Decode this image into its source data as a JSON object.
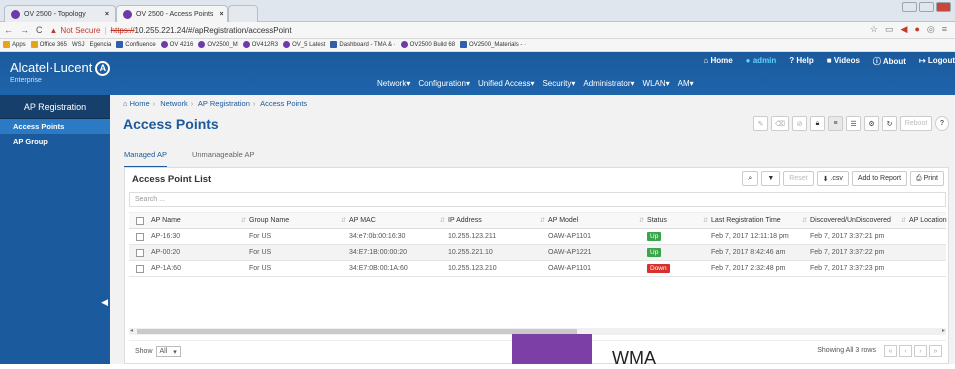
{
  "browser": {
    "tabs": [
      {
        "title": "OV 2500 - Topology"
      },
      {
        "title": "OV 2500 - Access Points"
      }
    ],
    "not_secure": "Not Secure",
    "url_scheme": "https://",
    "url_rest": "10.255.221.24/#/apRegistration/accessPoint",
    "bookmarks": [
      "Apps",
      "Office 365",
      "WSJ",
      "Egencia",
      "Confluence",
      "OV 4216",
      "OV2500_M",
      "OV412R3",
      "OV_5 Latest",
      "Dashboard - TMA & ·",
      "OV2500 Build 68",
      "OV2500_Materials - ·"
    ]
  },
  "header": {
    "brand": "Alcatel·Lucent",
    "brand_sub": "Enterprise",
    "brand_mark": "A",
    "utils": {
      "home": "Home",
      "user": "admin",
      "help": "Help",
      "videos": "Videos",
      "about": "About",
      "logout": "Logout"
    },
    "menu": [
      "Network",
      "Configuration",
      "Unified Access",
      "Security",
      "Administrator",
      "WLAN",
      "AM"
    ]
  },
  "sidebar": {
    "title": "AP Registration",
    "items": [
      {
        "label": "Access Points",
        "active": true
      },
      {
        "label": "AP Group",
        "active": false
      }
    ]
  },
  "breadcrumb": [
    "Home",
    "Network",
    "AP Registration",
    "Access Points"
  ],
  "page_title": "Access Points",
  "toolbar": {
    "reboot": "Reboot",
    "help": "?"
  },
  "subtabs": [
    "Managed AP",
    "Unmanageable AP"
  ],
  "panel": {
    "title": "Access Point List",
    "buttons": {
      "reset": "Reset",
      "csv": ".csv",
      "add_report": "Add to Report",
      "print": "Print"
    },
    "search_placeholder": "Search ...",
    "columns": [
      "AP Name",
      "Group Name",
      "AP MAC",
      "IP Address",
      "AP Model",
      "Status",
      "Last Registration Time",
      "Discovered/UnDiscovered",
      "AP Location"
    ],
    "rows": [
      {
        "name": "AP-16:30",
        "group": "For US",
        "mac": "34:e7:0b:00:16:30",
        "ip": "10.255.123.211",
        "model": "OAW-AP1101",
        "status": "Up",
        "last_reg": "Feb 7, 2017 12:11:18 pm",
        "discovered": "Feb 7, 2017 3:37:21 pm"
      },
      {
        "name": "AP-00:20",
        "group": "For US",
        "mac": "34:E7:1B:00:00:20",
        "ip": "10.255.221.10",
        "model": "OAW-AP1221",
        "status": "Up",
        "last_reg": "Feb 7, 2017 8:42:46 am",
        "discovered": "Feb 7, 2017 3:37:22 pm"
      },
      {
        "name": "AP-1A:60",
        "group": "For US",
        "mac": "34:E7:0B:00:1A:60",
        "ip": "10.255.123.210",
        "model": "OAW-AP1101",
        "status": "Down",
        "last_reg": "Feb 7, 2017 2:32:48 pm",
        "discovered": "Feb 7, 2017 3:37:23 pm"
      }
    ],
    "show_label": "Show",
    "show_value": "All",
    "showing_text": "Showing All 3 rows",
    "pager": [
      "«",
      "‹",
      "›",
      "»"
    ]
  },
  "overlay_text": "WMA",
  "colors": {
    "brand_blue": "#1b5a9c",
    "status_up": "#3aa64a",
    "status_down": "#d9302c",
    "overlay": "#7b3fa6"
  }
}
